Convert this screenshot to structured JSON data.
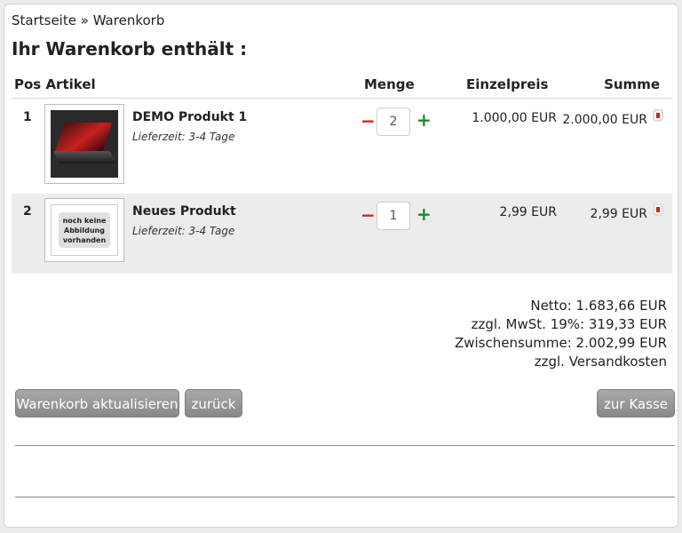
{
  "breadcrumb": {
    "home": "Startseite",
    "separator": " » ",
    "current": "Warenkorb"
  },
  "title": "Ihr Warenkorb enthält :",
  "table_header": {
    "pos_artikel": "Pos Artikel",
    "menge": "Menge",
    "einzelpreis": "Einzelpreis",
    "summe": "Summe"
  },
  "items": [
    {
      "pos": "1",
      "name": "DEMO Produkt 1",
      "delivery": "Lieferzeit: 3-4 Tage",
      "qty_minus": "−",
      "qty": "2",
      "qty_plus": "+",
      "unit_price": "1.000,00 EUR",
      "total": "2.000,00 EUR"
    },
    {
      "pos": "2",
      "name": "Neues Produkt",
      "delivery": "Lieferzeit: 3-4 Tage",
      "no_image": "noch keine Abbildung vorhanden",
      "qty_minus": "−",
      "qty": "1",
      "qty_plus": "+",
      "unit_price": "2,99 EUR",
      "total": "2,99 EUR"
    }
  ],
  "totals": {
    "netto": "Netto: 1.683,66 EUR",
    "mwst": "zzgl. MwSt. 19%: 319,33 EUR",
    "zwischensumme": "Zwischensumme: 2.002,99 EUR",
    "versand": "zzgl. Versandkosten"
  },
  "buttons": {
    "update": "Warenkorb aktualisieren",
    "back": "zurück",
    "checkout": "zur Kasse"
  }
}
